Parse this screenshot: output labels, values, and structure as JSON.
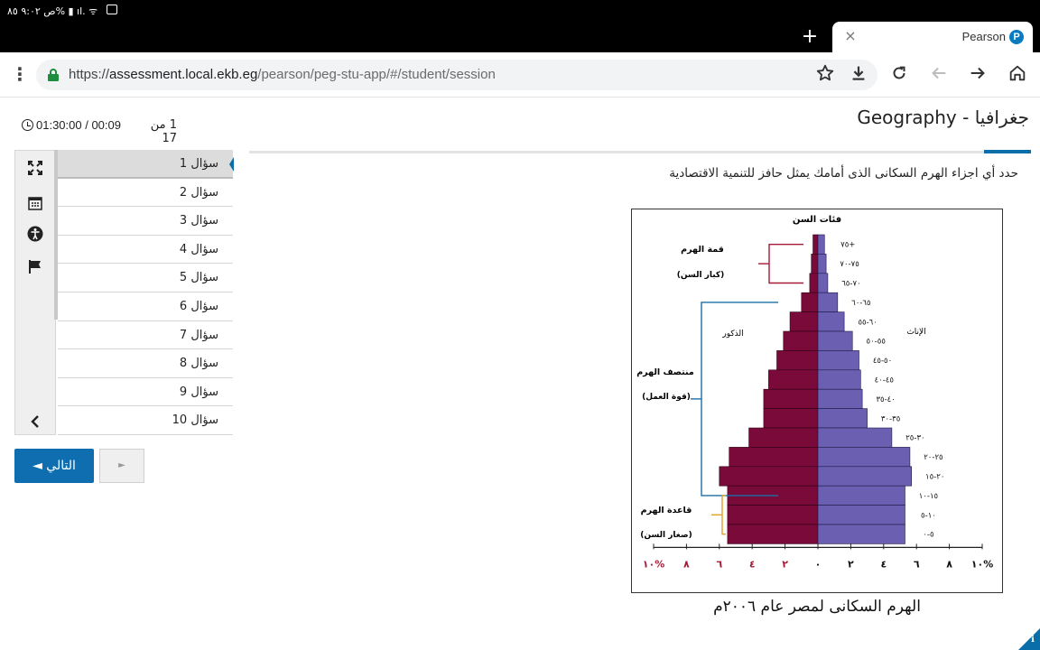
{
  "status_bar": {
    "text": "ص ٩:٠٢ ٨٥% ▮ ıl. ᯤ"
  },
  "browser": {
    "new_tab_label": "+",
    "tab": {
      "title": "Pearson",
      "favicon_glyph": "P",
      "close_glyph": "×"
    },
    "url": {
      "protocol": "https://",
      "host": "assessment.local.ekb.eg",
      "path": "/pearson/peg-stu-app/#/student/session"
    },
    "icons": {
      "menu": "more-vert",
      "bookmark": "star",
      "download": "download",
      "reload": "reload",
      "back": "arrow-left",
      "forward": "arrow-right",
      "home": "home"
    }
  },
  "header": {
    "timer": "01:30:00 / 00:09",
    "progress": "1 من 17",
    "title": "Geography - جغرافيا"
  },
  "tools": {
    "expand": "expand",
    "calendar": "calendar",
    "accessibility": "accessibility",
    "flag": "flag",
    "collapse": "chevron-left"
  },
  "questions": [
    {
      "label": "سؤال 1",
      "active": true
    },
    {
      "label": "سؤال 2"
    },
    {
      "label": "سؤال 3"
    },
    {
      "label": "سؤال 4"
    },
    {
      "label": "سؤال 5"
    },
    {
      "label": "سؤال 6"
    },
    {
      "label": "سؤال 7"
    },
    {
      "label": "سؤال 8"
    },
    {
      "label": "سؤال 9"
    },
    {
      "label": "سؤال 10"
    }
  ],
  "nav": {
    "next_label": "التالي ◄",
    "prev_label": "►"
  },
  "question": {
    "text": "حدد أي اجزاء الهرم السكانى الذى أمامك يمثل حافز للتنمية الاقتصادية"
  },
  "figure": {
    "caption": "الهرم السكانى لمصر عام ٢٠٠٦م",
    "left_group_label": "الذكور",
    "right_group_label": "الإناث",
    "axis_title": "فئات السن",
    "annotations": [
      {
        "title": "قمة الهرم",
        "subtitle": "(كبار السن)",
        "color": "#a31b37"
      },
      {
        "title": "منتصف الهرم",
        "subtitle": "(قوة العمل)",
        "color": "#1b6fa6"
      },
      {
        "title": "قاعدة الهرم",
        "subtitle": "(صغار السن)",
        "color": "#e0a02a"
      }
    ]
  },
  "chart_data": {
    "type": "bar",
    "orientation": "horizontal-pyramid",
    "title": "الهرم السكانى لمصر عام ٢٠٠٦م",
    "categories": [
      "٧٥+",
      "٧٥-٧٠",
      "٧٠-٦٥",
      "٦٥-٦٠",
      "٦٠-٥٥",
      "٥٥-٥٠",
      "٥٠-٤٥",
      "٤٥-٤٠",
      "٤٠-٣٥",
      "٣٥-٣٠",
      "٣٠-٢٥",
      "٢٥-٢٠",
      "٢٠-١٥",
      "١٥-١٠",
      "١٠-٥",
      "٥-٠"
    ],
    "series": [
      {
        "name": "الذكور",
        "color": "#7a0a3a",
        "values": [
          0.3,
          0.4,
          0.5,
          1.0,
          1.7,
          2.1,
          2.5,
          3.0,
          3.3,
          3.3,
          4.2,
          5.4,
          6.0,
          5.5,
          5.5,
          5.5
        ]
      },
      {
        "name": "الإناث",
        "color": "#6a5fb0",
        "values": [
          0.4,
          0.5,
          0.6,
          1.2,
          1.6,
          2.1,
          2.5,
          2.6,
          2.7,
          3.0,
          4.5,
          5.6,
          5.7,
          5.3,
          5.3,
          5.3
        ]
      }
    ],
    "xlim": [
      -10,
      10
    ],
    "x_ticks": [
      {
        "value": -10,
        "label": "١٠%"
      },
      {
        "value": -8,
        "label": "٨"
      },
      {
        "value": -6,
        "label": "٦"
      },
      {
        "value": -4,
        "label": "٤"
      },
      {
        "value": -2,
        "label": "٢"
      },
      {
        "value": 0,
        "label": "٠"
      },
      {
        "value": 2,
        "label": "٢"
      },
      {
        "value": 4,
        "label": "٤"
      },
      {
        "value": 6,
        "label": "٦"
      },
      {
        "value": 8,
        "label": "٨"
      },
      {
        "value": 10,
        "label": "١٠%"
      }
    ],
    "x_tick_colors": {
      "negative": "#a31b37",
      "positive": "#111111"
    },
    "grid": false
  }
}
